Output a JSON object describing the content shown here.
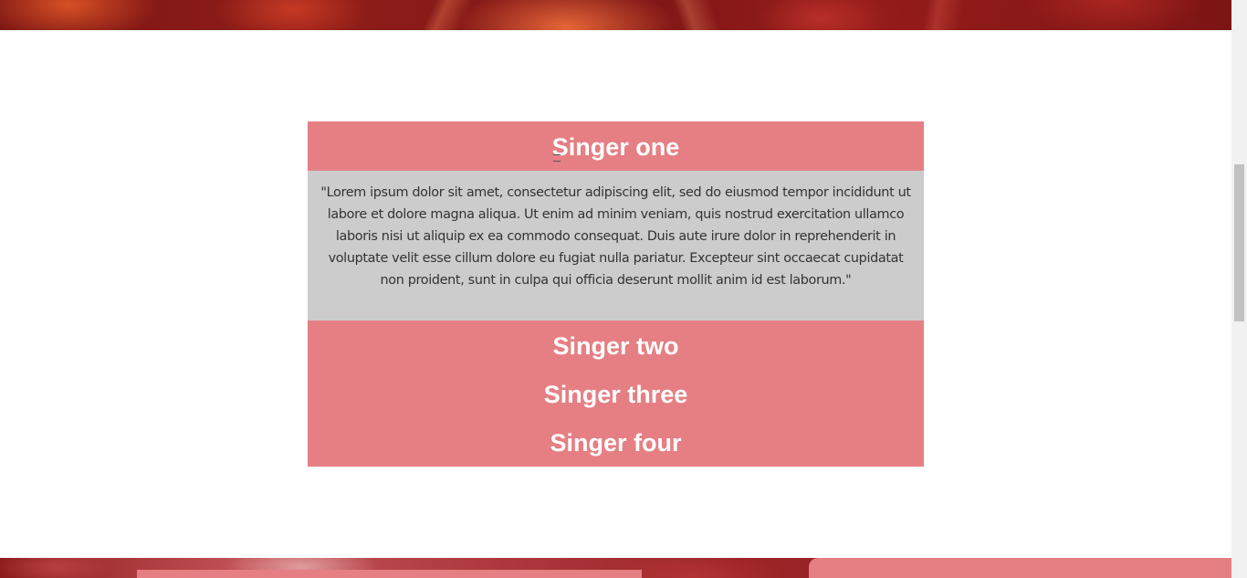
{
  "accordion": {
    "items": [
      {
        "title": "Singer one",
        "expanded": true,
        "body": "\"Lorem ipsum dolor sit amet, consectetur adipiscing elit, sed do eiusmod tempor incididunt ut labore et dolore magna aliqua. Ut enim ad minim veniam, quis nostrud exercitation ullamco laboris nisi ut aliquip ex ea commodo consequat. Duis aute irure dolor in reprehenderit in voluptate velit esse cillum dolore eu fugiat nulla pariatur. Excepteur sint occaecat cupidatat non proident, sunt in culpa qui officia deserunt mollit anim id est laborum.\""
      },
      {
        "title": "Singer two",
        "expanded": false
      },
      {
        "title": "Singer three",
        "expanded": false
      },
      {
        "title": "Singer four",
        "expanded": false
      }
    ]
  },
  "colors": {
    "header_bg": "#e57f83",
    "header_text": "#ffffff",
    "panel_bg": "#cccccc",
    "panel_text": "#333333",
    "banner": "#7a1514"
  }
}
